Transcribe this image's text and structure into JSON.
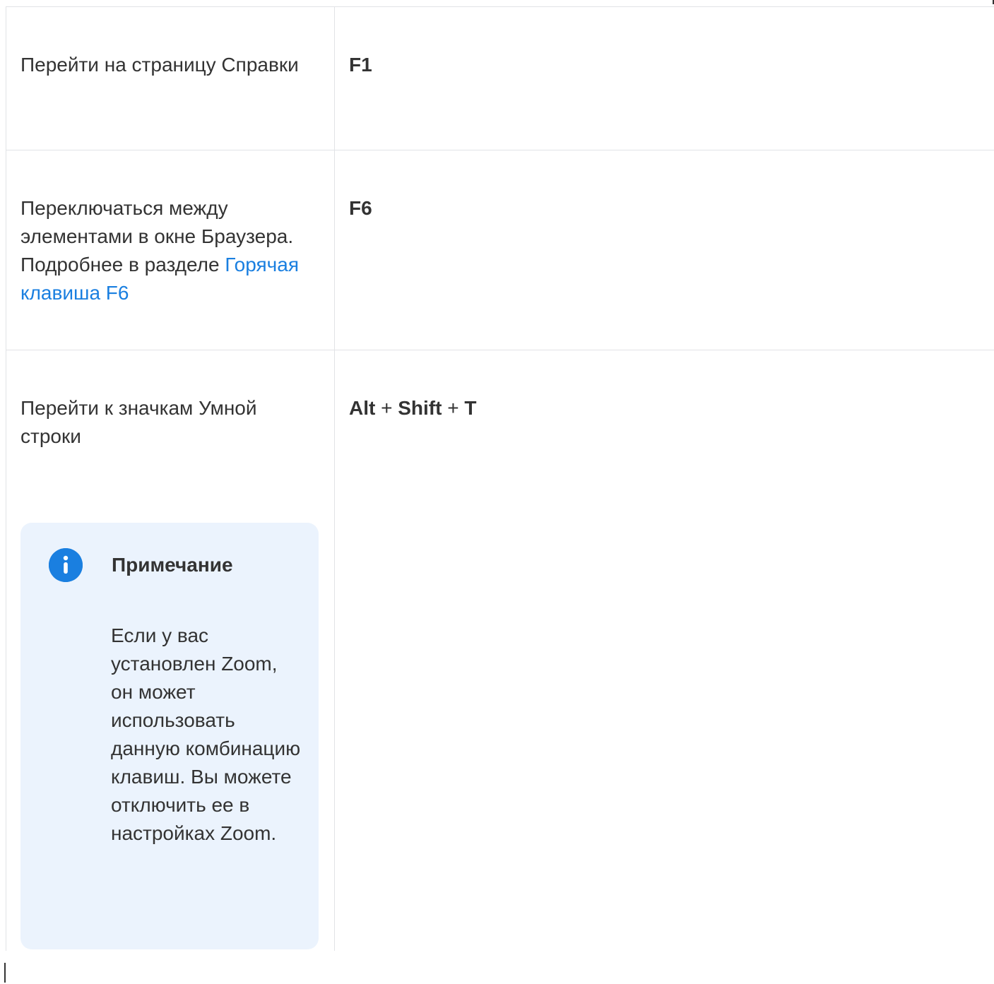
{
  "rows": [
    {
      "action": "Перейти на страницу Справки",
      "keys": [
        "F1"
      ]
    },
    {
      "action_text": "Переключаться между элементами в окне Браузера. Подробнее в разделе",
      "action_link": "Горячая клавиша F6",
      "keys": [
        "F6"
      ]
    },
    {
      "action": "Перейти к значкам Умной строки",
      "keys": [
        "Alt",
        "Shift",
        "T"
      ],
      "separator": "+",
      "note": {
        "icon": "info-icon",
        "title": "Примечание",
        "text": "Если у вас установлен Zoom, он может использовать данную комбинацию клавиш. Вы можете отключить ее в настройках Zoom."
      }
    }
  ],
  "colors": {
    "text": "#333333",
    "link": "#1a7fe0",
    "note_background": "#ebf3fd",
    "border": "#e1e3e6",
    "icon": "#1a7fe0"
  }
}
